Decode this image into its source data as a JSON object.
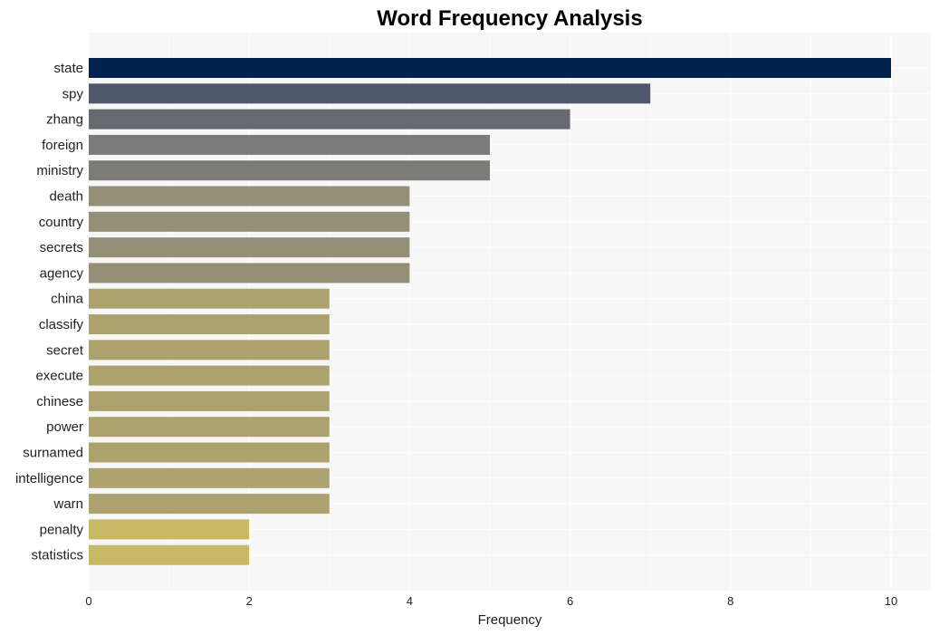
{
  "chart_data": {
    "type": "bar",
    "orientation": "horizontal",
    "title": "Word Frequency Analysis",
    "xlabel": "Frequency",
    "ylabel": "",
    "xlim": [
      0,
      10.5
    ],
    "xticks": [
      0,
      2,
      4,
      6,
      8,
      10
    ],
    "grid": true,
    "legend": "none",
    "categories": [
      "state",
      "spy",
      "zhang",
      "foreign",
      "ministry",
      "death",
      "country",
      "secrets",
      "agency",
      "china",
      "classify",
      "secret",
      "execute",
      "chinese",
      "power",
      "surnamed",
      "intelligence",
      "warn",
      "penalty",
      "statistics"
    ],
    "values": [
      10,
      7,
      6,
      5,
      5,
      4,
      4,
      4,
      4,
      3,
      3,
      3,
      3,
      3,
      3,
      3,
      3,
      3,
      2,
      2
    ],
    "colors": [
      "#00224e",
      "#4f576c",
      "#676970",
      "#7c7b78",
      "#7c7b78",
      "#958f78",
      "#958f78",
      "#958f78",
      "#958f78",
      "#aca26f",
      "#aca26f",
      "#aca26f",
      "#aca26f",
      "#aca26f",
      "#aca26f",
      "#aca26f",
      "#aca26f",
      "#aca26f",
      "#c9b866",
      "#c9b866"
    ]
  },
  "style": {
    "plot_background": "#f7f7f7",
    "grid_color": "#ffffff"
  }
}
